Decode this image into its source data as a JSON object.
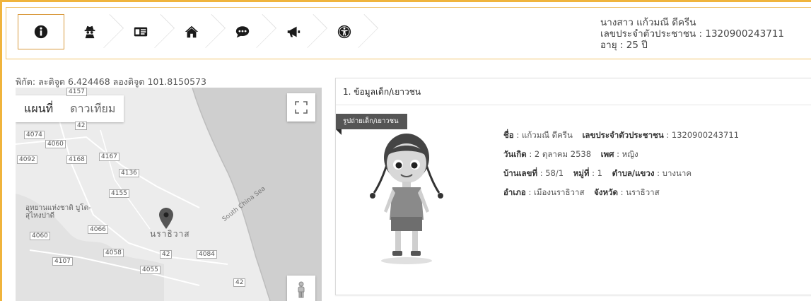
{
  "header": {
    "tabs": [
      {
        "name": "info",
        "active": true
      },
      {
        "name": "person-disguise",
        "active": false
      },
      {
        "name": "id-card",
        "active": false
      },
      {
        "name": "home",
        "active": false
      },
      {
        "name": "comment",
        "active": false
      },
      {
        "name": "bullhorn",
        "active": false
      },
      {
        "name": "accessibility",
        "active": false
      }
    ],
    "profile": {
      "name": "นางสาว แก้วมณี ดีครีน",
      "id_line": "เลขประจำตัวประชาชน : 1320900243711",
      "age_line": "อายุ : 25 ปี"
    }
  },
  "map": {
    "coords": "พิกัด: ละติจูด 6.424468 ลองติจูด 101.8150573",
    "tab_map": "แผนที่",
    "tab_satellite": "ดาวเทียม",
    "road_labels": [
      "4157",
      "42",
      "4074",
      "4060",
      "4092",
      "4168",
      "4167",
      "4136",
      "4155",
      "4060",
      "4066",
      "42",
      "4084",
      "4058",
      "4107",
      "4055",
      "42"
    ],
    "park_label": "อุทยานแห่งชาติ บูโด-สุไหงปาดี",
    "town_label": "นราธิวาส",
    "sea_label": "South China Sea"
  },
  "card": {
    "title": "1. ข้อมูลเด็ก/เยาวชน",
    "ribbon": "รูปถ่ายเด็ก/เยาวชน",
    "fields": {
      "name_label": "ชื่อ",
      "name_value": ": แก้วมณี ดีครีน",
      "id_label": "เลขประจำตัวประชาชน",
      "id_value": ": 1320900243711",
      "birth_label": "วันเกิด",
      "birth_value": ": 2 ตุลาคม 2538",
      "sex_label": "เพศ",
      "sex_value": ": หญิง",
      "house_label": "บ้านเลขที่",
      "house_value": ": 58/1",
      "moo_label": "หมู่ที่",
      "moo_value": ": 1",
      "tambon_label": "ตำบล/แขวง",
      "tambon_value": ": บางนาค",
      "amphoe_label": "อำเภอ",
      "amphoe_value": ": เมืองนราธิวาส",
      "province_label": "จังหวัด",
      "province_value": ": นราธิวาส"
    }
  },
  "colors": {
    "accent": "#f0b43c",
    "tab_active_border": "#d99a3e",
    "ribbon": "#555555"
  }
}
